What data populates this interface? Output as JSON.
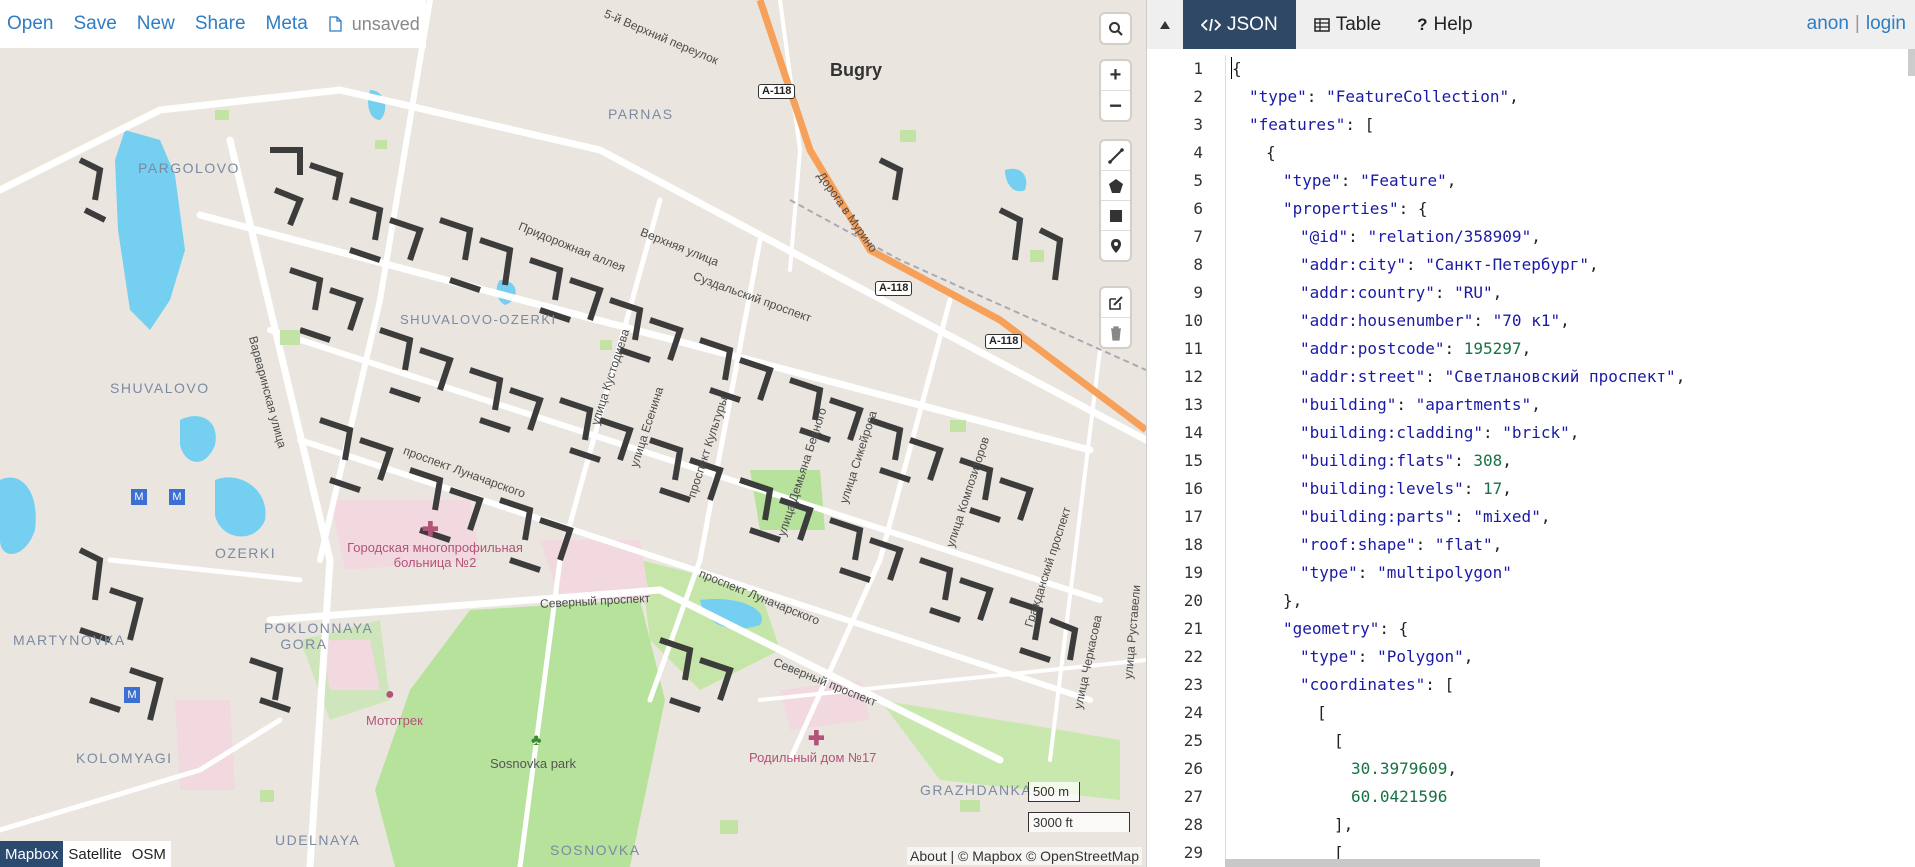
{
  "toolbar": {
    "items": [
      "Open",
      "Save",
      "New",
      "Share",
      "Meta"
    ],
    "status": "unsaved"
  },
  "map": {
    "districts": [
      "PARGOLOVO",
      "PARNAS",
      "SHUVALOVO",
      "SHUVALOVO-OZERKI",
      "OZERKI",
      "MARTYNOVKA",
      "POKLONNAYA GORA",
      "KOLOMYAGI",
      "UDELNAYA",
      "SOSNOVKA",
      "GRAZHDANKA"
    ],
    "place": "Bugry",
    "streets": [
      "5-й Верхний переулок",
      "Дорога в Мурино",
      "Верхняя улица",
      "Придорожная аллея",
      "Суздальский проспект",
      "Варваринская улица",
      "проспект Луначарского",
      "улица Кустодиева",
      "проспект Культуры",
      "улица Есенина",
      "улица Сикейроса",
      "улица Композиторов",
      "улица Демьяна Бедного",
      "Северный проспект",
      "Гражданский проспект",
      "улица Руставели",
      "улица Черкасова"
    ],
    "shields": [
      "A-118",
      "A-118",
      "A-118"
    ],
    "pois": [
      "Городская многопрофильная больница №2",
      "Мототрек",
      "Sosnovka park",
      "Родильный дом №17"
    ],
    "scale_metric": "500 m",
    "scale_imperial": "3000 ft",
    "layers": [
      "Mapbox",
      "Satellite",
      "OSM"
    ],
    "active_layer": "Mapbox",
    "attribution": "About | © Mapbox © OpenStreetMap"
  },
  "panel": {
    "tabs": [
      "JSON",
      "Table",
      "Help"
    ],
    "active_tab": "JSON",
    "auth_user": "anon",
    "auth_login": "login"
  },
  "editor": {
    "line_numbers": [
      "1",
      "2",
      "3",
      "4",
      "5",
      "6",
      "7",
      "8",
      "9",
      "10",
      "11",
      "12",
      "13",
      "14",
      "15",
      "16",
      "17",
      "18",
      "19",
      "20",
      "21",
      "22",
      "23",
      "24",
      "25",
      "26",
      "27",
      "28",
      "29"
    ],
    "lines": [
      {
        "indent": 0,
        "parts": [
          [
            "p",
            "{"
          ]
        ]
      },
      {
        "indent": 1,
        "parts": [
          [
            "k",
            "\"type\""
          ],
          [
            "p",
            ": "
          ],
          [
            "s",
            "\"FeatureCollection\""
          ],
          [
            "p",
            ","
          ]
        ]
      },
      {
        "indent": 1,
        "parts": [
          [
            "k",
            "\"features\""
          ],
          [
            "p",
            ": ["
          ]
        ]
      },
      {
        "indent": 2,
        "parts": [
          [
            "p",
            "{"
          ]
        ]
      },
      {
        "indent": 3,
        "parts": [
          [
            "k",
            "\"type\""
          ],
          [
            "p",
            ": "
          ],
          [
            "s",
            "\"Feature\""
          ],
          [
            "p",
            ","
          ]
        ]
      },
      {
        "indent": 3,
        "parts": [
          [
            "k",
            "\"properties\""
          ],
          [
            "p",
            ": {"
          ]
        ]
      },
      {
        "indent": 4,
        "parts": [
          [
            "k",
            "\"@id\""
          ],
          [
            "p",
            ": "
          ],
          [
            "s",
            "\"relation/358909\""
          ],
          [
            "p",
            ","
          ]
        ]
      },
      {
        "indent": 4,
        "parts": [
          [
            "k",
            "\"addr:city\""
          ],
          [
            "p",
            ": "
          ],
          [
            "s",
            "\"Санкт-Петербург\""
          ],
          [
            "p",
            ","
          ]
        ]
      },
      {
        "indent": 4,
        "parts": [
          [
            "k",
            "\"addr:country\""
          ],
          [
            "p",
            ": "
          ],
          [
            "s",
            "\"RU\""
          ],
          [
            "p",
            ","
          ]
        ]
      },
      {
        "indent": 4,
        "parts": [
          [
            "k",
            "\"addr:housenumber\""
          ],
          [
            "p",
            ": "
          ],
          [
            "s",
            "\"70 к1\""
          ],
          [
            "p",
            ","
          ]
        ]
      },
      {
        "indent": 4,
        "parts": [
          [
            "k",
            "\"addr:postcode\""
          ],
          [
            "p",
            ": "
          ],
          [
            "n",
            "195297"
          ],
          [
            "p",
            ","
          ]
        ]
      },
      {
        "indent": 4,
        "parts": [
          [
            "k",
            "\"addr:street\""
          ],
          [
            "p",
            ": "
          ],
          [
            "s",
            "\"Светлановский проспект\""
          ],
          [
            "p",
            ","
          ]
        ]
      },
      {
        "indent": 4,
        "parts": [
          [
            "k",
            "\"building\""
          ],
          [
            "p",
            ": "
          ],
          [
            "s",
            "\"apartments\""
          ],
          [
            "p",
            ","
          ]
        ]
      },
      {
        "indent": 4,
        "parts": [
          [
            "k",
            "\"building:cladding\""
          ],
          [
            "p",
            ": "
          ],
          [
            "s",
            "\"brick\""
          ],
          [
            "p",
            ","
          ]
        ]
      },
      {
        "indent": 4,
        "parts": [
          [
            "k",
            "\"building:flats\""
          ],
          [
            "p",
            ": "
          ],
          [
            "n",
            "308"
          ],
          [
            "p",
            ","
          ]
        ]
      },
      {
        "indent": 4,
        "parts": [
          [
            "k",
            "\"building:levels\""
          ],
          [
            "p",
            ": "
          ],
          [
            "n",
            "17"
          ],
          [
            "p",
            ","
          ]
        ]
      },
      {
        "indent": 4,
        "parts": [
          [
            "k",
            "\"building:parts\""
          ],
          [
            "p",
            ": "
          ],
          [
            "s",
            "\"mixed\""
          ],
          [
            "p",
            ","
          ]
        ]
      },
      {
        "indent": 4,
        "parts": [
          [
            "k",
            "\"roof:shape\""
          ],
          [
            "p",
            ": "
          ],
          [
            "s",
            "\"flat\""
          ],
          [
            "p",
            ","
          ]
        ]
      },
      {
        "indent": 4,
        "parts": [
          [
            "k",
            "\"type\""
          ],
          [
            "p",
            ": "
          ],
          [
            "s",
            "\"multipolygon\""
          ]
        ]
      },
      {
        "indent": 3,
        "parts": [
          [
            "p",
            "},"
          ]
        ]
      },
      {
        "indent": 3,
        "parts": [
          [
            "k",
            "\"geometry\""
          ],
          [
            "p",
            ": {"
          ]
        ]
      },
      {
        "indent": 4,
        "parts": [
          [
            "k",
            "\"type\""
          ],
          [
            "p",
            ": "
          ],
          [
            "s",
            "\"Polygon\""
          ],
          [
            "p",
            ","
          ]
        ]
      },
      {
        "indent": 4,
        "parts": [
          [
            "k",
            "\"coordinates\""
          ],
          [
            "p",
            ": ["
          ]
        ]
      },
      {
        "indent": 5,
        "parts": [
          [
            "p",
            "["
          ]
        ]
      },
      {
        "indent": 6,
        "parts": [
          [
            "p",
            "["
          ]
        ]
      },
      {
        "indent": 7,
        "parts": [
          [
            "n",
            "30.3979609"
          ],
          [
            "p",
            ","
          ]
        ]
      },
      {
        "indent": 7,
        "parts": [
          [
            "n",
            "60.0421596"
          ]
        ]
      },
      {
        "indent": 6,
        "parts": [
          [
            "p",
            "],"
          ]
        ]
      },
      {
        "indent": 6,
        "parts": [
          [
            "p",
            "["
          ]
        ]
      }
    ]
  },
  "colors": {
    "link": "#2f7dc3",
    "active_tab_bg": "#2f4866",
    "json_key": "#1a1aa6",
    "json_number": "#177243",
    "park": "#b7e29b",
    "water": "#75cff0",
    "motorway": "#f6a05a",
    "building": "#3c3c3c"
  }
}
